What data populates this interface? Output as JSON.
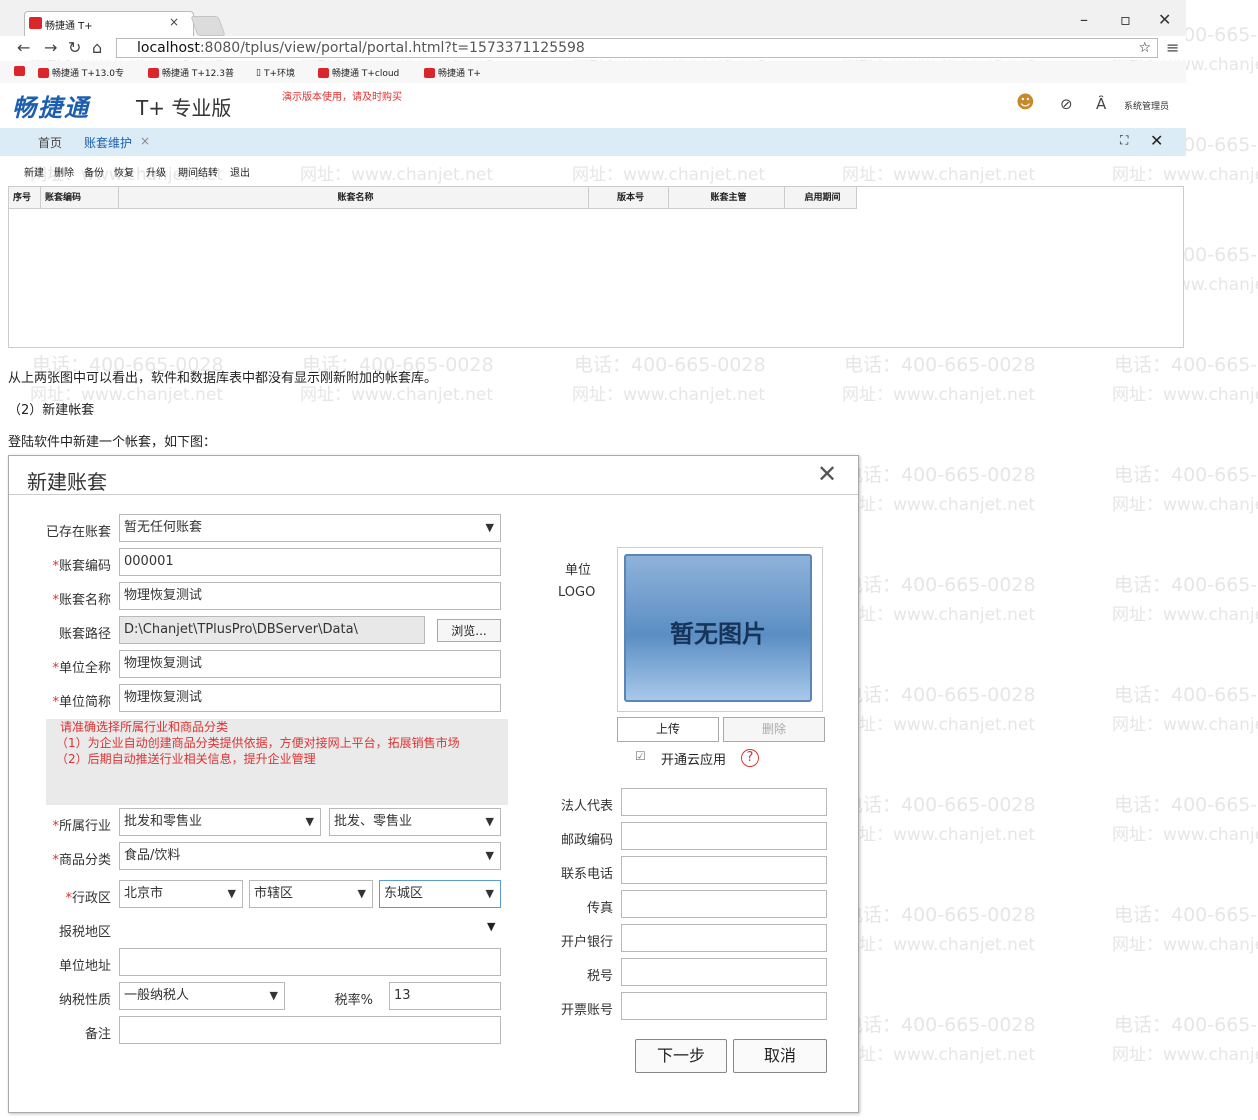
{
  "browser": {
    "tab_title": "畅捷通 T+",
    "url_host": "localhost",
    "url_rest": ":8080/tplus/view/portal/portal.html?t=1573371125598",
    "bookmarks": [
      "畅捷通 T+13.0专",
      "畅捷通 T+12.3普",
      "T+环境",
      "畅捷通 T+cloud",
      "畅捷通 T+"
    ],
    "controls": {
      "minimize": "–",
      "maximize": "▫",
      "close": "✕"
    }
  },
  "app": {
    "brand": "畅捷通",
    "edition": "T+ 专业版",
    "demo_notice": "演示版本使用，请及时购买",
    "user": "系统管理员",
    "tabs": [
      "首页",
      "账套维护"
    ],
    "toolbar": [
      "新建",
      "删除",
      "备份",
      "恢复",
      "升级",
      "期间结转",
      "退出"
    ],
    "columns": [
      "序号",
      "账套编码",
      "账套名称",
      "版本号",
      "账套主管",
      "启用期间"
    ]
  },
  "article": {
    "line1": "从上两张图中可以看出，软件和数据库表中都没有显示刚新附加的帐套库。",
    "line2": "（2）新建帐套",
    "line3": "登陆软件中新建一个帐套，如下图："
  },
  "watermark": {
    "phone": "电话：400-665-0028",
    "site": "网址：www.chanjet.net"
  },
  "dialog": {
    "title": "新建账套",
    "labels": {
      "existing": "已存在账套",
      "code": "账套编码",
      "name": "账套名称",
      "path": "账套路径",
      "fullname": "单位全称",
      "shortname": "单位简称",
      "industry": "所属行业",
      "category": "商品分类",
      "region": "行政区",
      "tax_region": "报税地区",
      "address": "单位地址",
      "tax_nature": "纳税性质",
      "tax_rate": "税率%",
      "remark": "备注",
      "logo1": "单位",
      "logo2": "LOGO",
      "legal": "法人代表",
      "postcode": "邮政编码",
      "phone": "联系电话",
      "fax": "传真",
      "bank": "开户银行",
      "tax_no": "税号",
      "invoice": "开票账号"
    },
    "values": {
      "existing": "暂无任何账套",
      "code": "000001",
      "name": "物理恢复测试",
      "path": "D:\\Chanjet\\TPlusPro\\DBServer\\Data\\",
      "fullname": "物理恢复测试",
      "shortname": "物理恢复测试",
      "industry1": "批发和零售业",
      "industry2": "批发、零售业",
      "category": "食品/饮料",
      "region1": "北京市",
      "region2": "市辖区",
      "region3": "东城区",
      "tax_nature": "一般纳税人",
      "tax_rate": "13"
    },
    "notice": [
      "请准确选择所属行业和商品分类",
      "（1）为企业自动创建商品分类提供依据，方便对接网上平台，拓展销售市场",
      "（2）后期自动推送行业相关信息，提升企业管理"
    ],
    "buttons": {
      "browse": "浏览...",
      "upload": "上传",
      "delete": "删除",
      "next": "下一步",
      "cancel": "取消"
    },
    "logo_placeholder": "暂无图片",
    "cloud": "开通云应用"
  }
}
